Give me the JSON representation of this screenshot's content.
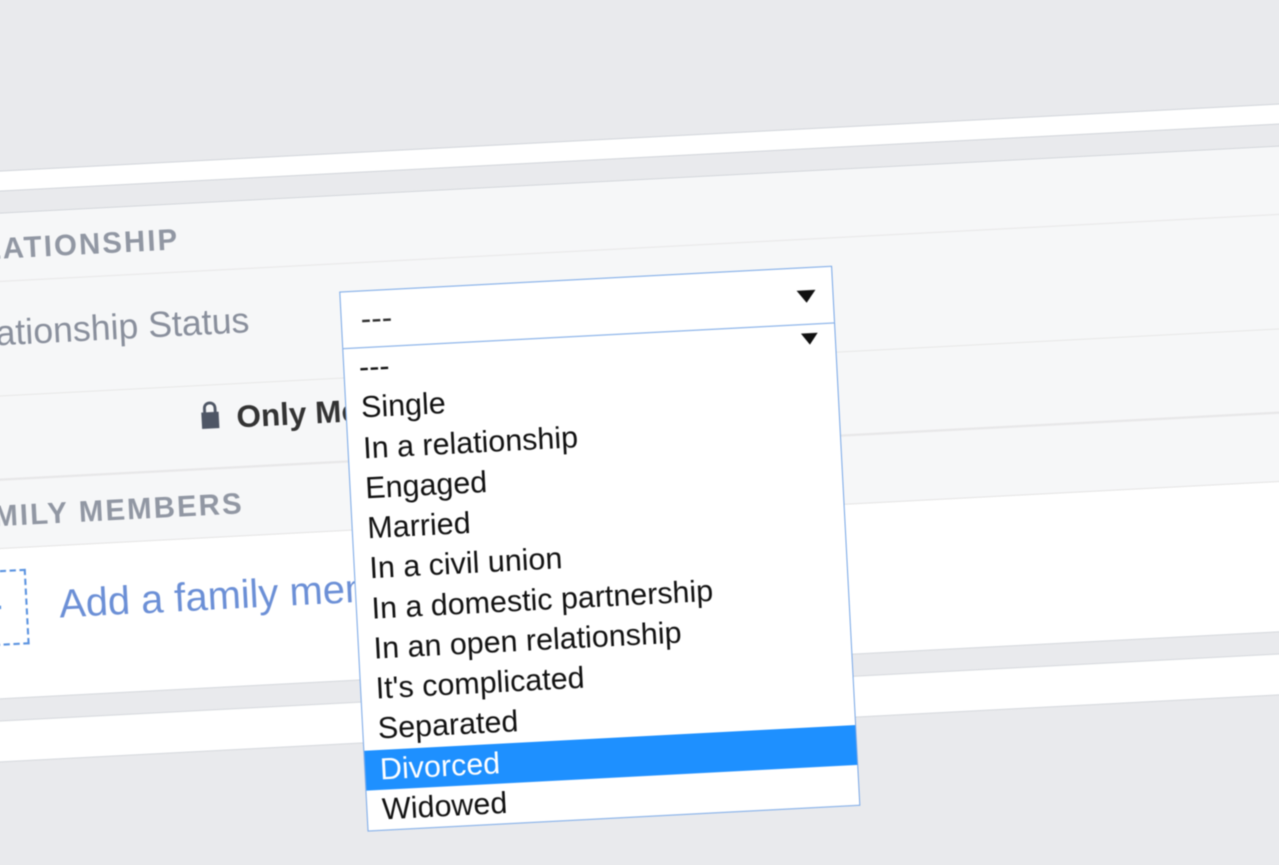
{
  "sections": {
    "relationship": {
      "header": "RELATIONSHIP",
      "status_label": "Relationship Status",
      "status_selected": "---",
      "options": [
        "---",
        "Single",
        "In a relationship",
        "Engaged",
        "Married",
        "In a civil union",
        "In a domestic partnership",
        "In an open relationship",
        "It's complicated",
        "Separated",
        "Divorced",
        "Widowed"
      ],
      "highlighted_option": "Divorced",
      "privacy_label": "Only Me"
    },
    "family": {
      "header": "FAMILY MEMBERS",
      "add_label": "Add a family member",
      "add_glyph": "+"
    }
  }
}
